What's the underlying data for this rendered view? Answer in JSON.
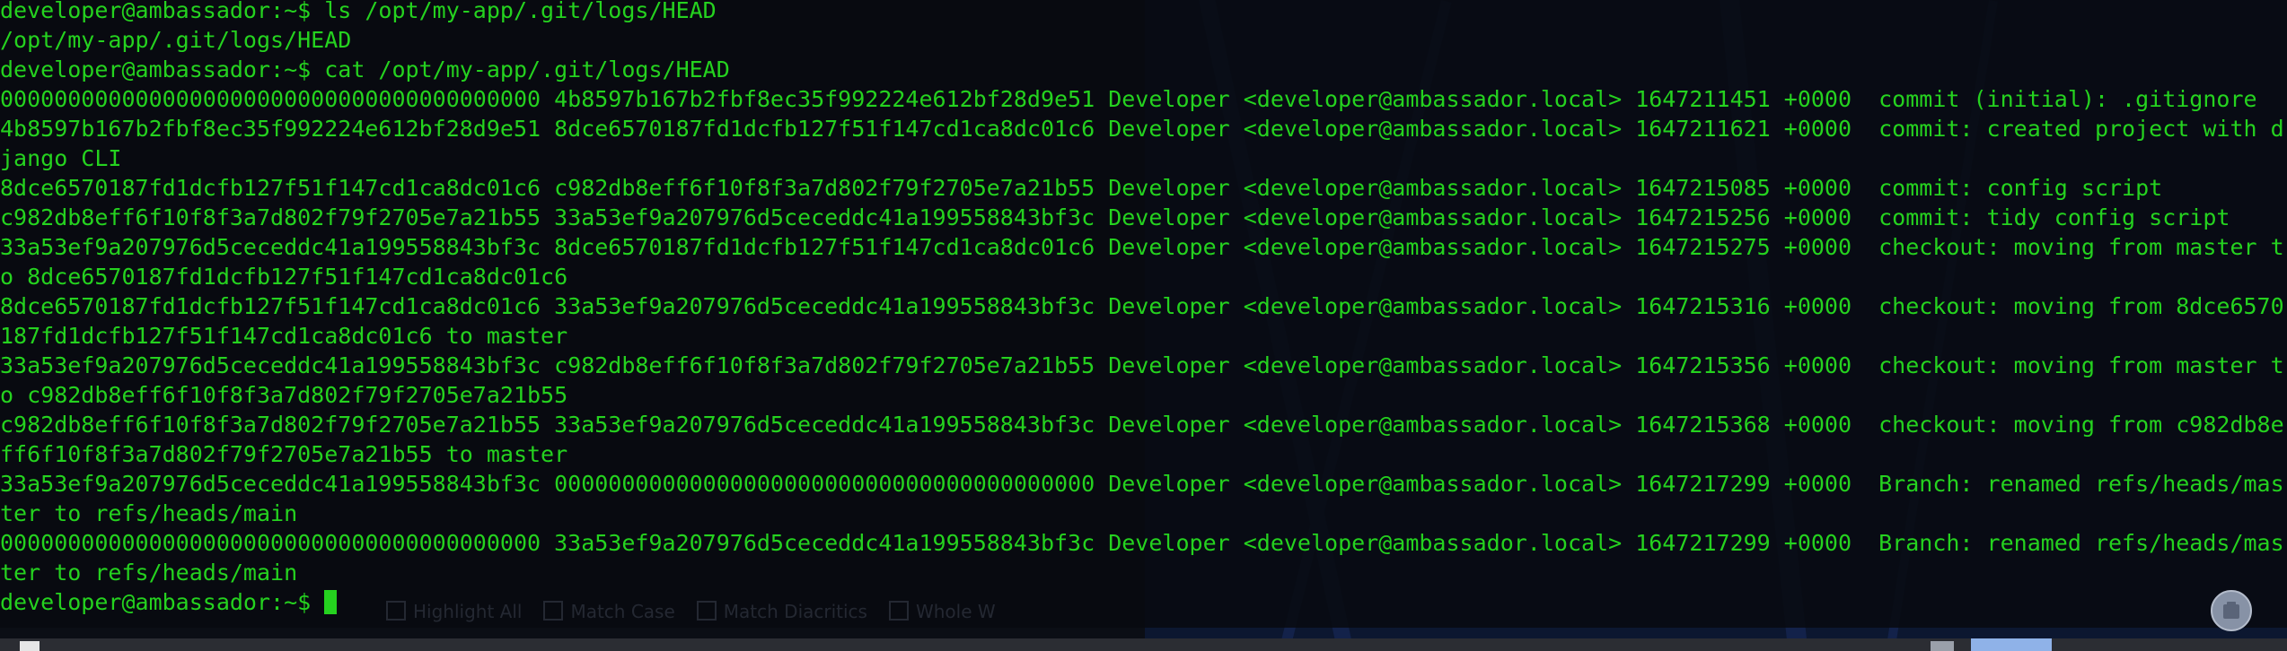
{
  "terminal": {
    "prompt": "developer@ambassador:~$ ",
    "lines": [
      "developer@ambassador:~$ ls /opt/my-app/.git/logs/HEAD",
      "/opt/my-app/.git/logs/HEAD",
      "developer@ambassador:~$ cat /opt/my-app/.git/logs/HEAD",
      "0000000000000000000000000000000000000000 4b8597b167b2fbf8ec35f992224e612bf28d9e51 Developer <developer@ambassador.local> 1647211451 +0000  commit (initial): .gitignore",
      "4b8597b167b2fbf8ec35f992224e612bf28d9e51 8dce6570187fd1dcfb127f51f147cd1ca8dc01c6 Developer <developer@ambassador.local> 1647211621 +0000  commit: created project with d",
      "jango CLI",
      "8dce6570187fd1dcfb127f51f147cd1ca8dc01c6 c982db8eff6f10f8f3a7d802f79f2705e7a21b55 Developer <developer@ambassador.local> 1647215085 +0000  commit: config script",
      "c982db8eff6f10f8f3a7d802f79f2705e7a21b55 33a53ef9a207976d5ceceddc41a199558843bf3c Developer <developer@ambassador.local> 1647215256 +0000  commit: tidy config script",
      "33a53ef9a207976d5ceceddc41a199558843bf3c 8dce6570187fd1dcfb127f51f147cd1ca8dc01c6 Developer <developer@ambassador.local> 1647215275 +0000  checkout: moving from master t",
      "o 8dce6570187fd1dcfb127f51f147cd1ca8dc01c6",
      "8dce6570187fd1dcfb127f51f147cd1ca8dc01c6 33a53ef9a207976d5ceceddc41a199558843bf3c Developer <developer@ambassador.local> 1647215316 +0000  checkout: moving from 8dce6570",
      "187fd1dcfb127f51f147cd1ca8dc01c6 to master",
      "33a53ef9a207976d5ceceddc41a199558843bf3c c982db8eff6f10f8f3a7d802f79f2705e7a21b55 Developer <developer@ambassador.local> 1647215356 +0000  checkout: moving from master t",
      "o c982db8eff6f10f8f3a7d802f79f2705e7a21b55",
      "c982db8eff6f10f8f3a7d802f79f2705e7a21b55 33a53ef9a207976d5ceceddc41a199558843bf3c Developer <developer@ambassador.local> 1647215368 +0000  checkout: moving from c982db8e",
      "ff6f10f8f3a7d802f79f2705e7a21b55 to master",
      "33a53ef9a207976d5ceceddc41a199558843bf3c 0000000000000000000000000000000000000000 Developer <developer@ambassador.local> 1647217299 +0000  Branch: renamed refs/heads/mas",
      "ter to refs/heads/main",
      "0000000000000000000000000000000000000000 33a53ef9a207976d5ceceddc41a199558843bf3c Developer <developer@ambassador.local> 1647217299 +0000  Branch: renamed refs/heads/mas",
      "ter to refs/heads/main"
    ]
  },
  "ghost_findbar": {
    "highlight_all": "Highlight All",
    "match_case": "Match Case",
    "match_diacritics": "Match Diacritics",
    "whole_words": "Whole W"
  },
  "colors": {
    "terminal_text": "#25d21f",
    "terminal_bg": "#080a10"
  },
  "icons": {
    "avatar": "user-avatar-icon"
  }
}
